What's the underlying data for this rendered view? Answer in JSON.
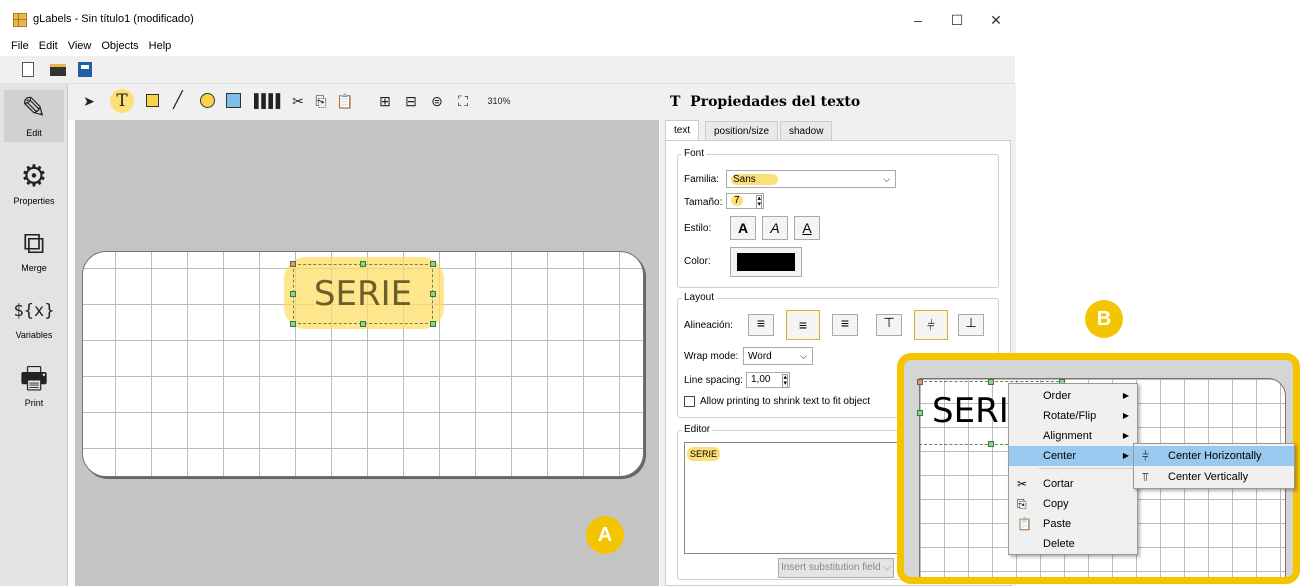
{
  "window": {
    "title": "gLabels - Sin título1 (modificado)",
    "min": "–",
    "max": "☐",
    "close": "✕"
  },
  "menu": [
    "File",
    "Edit",
    "View",
    "Objects",
    "Help"
  ],
  "sidebar": [
    {
      "label": "Edit",
      "icon": "✎"
    },
    {
      "label": "Properties",
      "icon": "⚙"
    },
    {
      "label": "Merge",
      "icon": "⧉"
    },
    {
      "label": "Variables",
      "icon": "${x}"
    },
    {
      "label": "Print",
      "icon": "🖶"
    }
  ],
  "toolbar": {
    "zoom": "310%"
  },
  "canvas": {
    "text": "SERIE"
  },
  "props": {
    "title": "Propiedades del texto",
    "title_icon": "T",
    "tabs": [
      "text",
      "position/size",
      "shadow"
    ],
    "font": {
      "group": "Font",
      "family_label": "Familia:",
      "family": "Sans",
      "size_label": "Tamaño:",
      "size": "7",
      "style_label": "Estilo:",
      "color_label": "Color:",
      "color": "#000000"
    },
    "layout": {
      "group": "Layout",
      "align_label": "Alineación:",
      "wrap_label": "Wrap mode:",
      "wrap": "Word",
      "spacing_label": "Line spacing:",
      "spacing": "1,00",
      "shrink_label": "Allow printing to shrink text to fit object"
    },
    "editor": {
      "group": "Editor",
      "text": "SERIE",
      "insert": "Insert substitution field"
    }
  },
  "callout": {
    "a": "A",
    "b": "B"
  },
  "zoomview": {
    "text": "SERI"
  },
  "context_menu": {
    "items": [
      "Order",
      "Rotate/Flip",
      "Alignment",
      "Center",
      "Cortar",
      "Copy",
      "Paste",
      "Delete"
    ],
    "submenu": [
      "Center Horizontally",
      "Center Vertically"
    ]
  },
  "colors": {
    "highlight": "#fbe07a",
    "accent": "#f5c400",
    "selected": "#99c9ef"
  }
}
